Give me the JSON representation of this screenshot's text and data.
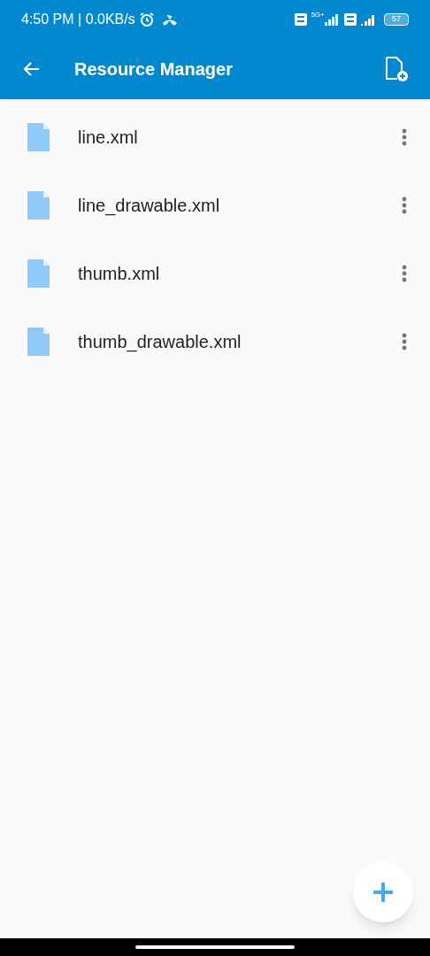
{
  "status_bar": {
    "time_speed": "4:50 PM | 0.0KB/s",
    "network": "5G+",
    "battery": "57"
  },
  "app_bar": {
    "title": "Resource Manager"
  },
  "files": [
    {
      "name": "line.xml"
    },
    {
      "name": "line_drawable.xml"
    },
    {
      "name": "thumb.xml"
    },
    {
      "name": "thumb_drawable.xml"
    }
  ]
}
